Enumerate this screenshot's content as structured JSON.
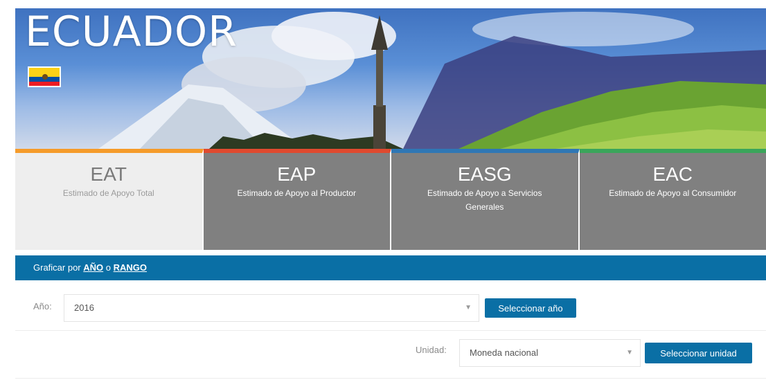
{
  "banner": {
    "title": "ECUADOR",
    "flag_colors": [
      "#fcd116",
      "#034ea2",
      "#ed1c24"
    ]
  },
  "tabs": [
    {
      "key": "eat",
      "title": "EAT",
      "subtitle": "Estimado de Apoyo Total",
      "accent": "#f59b2a",
      "active": true
    },
    {
      "key": "eap",
      "title": "EAP",
      "subtitle": "Estimado de Apoyo al Productor",
      "accent": "#e04a2f",
      "active": false
    },
    {
      "key": "easg",
      "title": "EASG",
      "subtitle": "Estimado de Apoyo a Servicios Generales",
      "accent": "#2f77b5",
      "active": false
    },
    {
      "key": "eac",
      "title": "EAC",
      "subtitle": "Estimado de Apoyo al Consumidor",
      "accent": "#3aa55b",
      "active": false
    }
  ],
  "graph_bar": {
    "prefix": "Graficar por",
    "year_link": "AÑO",
    "connector": "o",
    "range_link": "RANGO",
    "color": "#0a6fa5"
  },
  "year_filter": {
    "label": "Año:",
    "selected": "2016",
    "button": "Seleccionar año"
  },
  "unit_filter": {
    "label": "Unidad:",
    "selected": "Moneda nacional",
    "button": "Seleccionar unidad"
  }
}
